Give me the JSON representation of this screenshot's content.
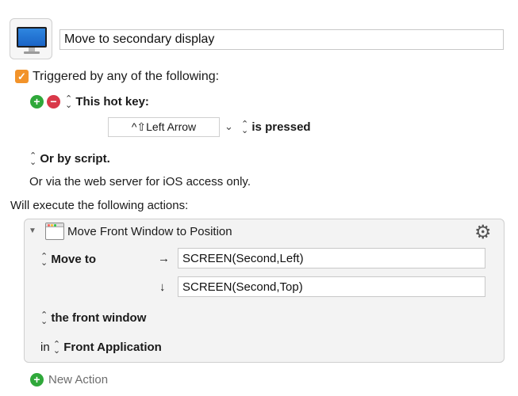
{
  "macro": {
    "icon": "monitor-icon",
    "name": "Move to secondary display"
  },
  "trigger": {
    "enabled": true,
    "label": "Triggered by any of the following:",
    "hotkey_label": "This hot key:",
    "hotkey_value": "^⇧Left Arrow",
    "hotkey_state": "is pressed",
    "script_label": "Or by script.",
    "web_label": "Or via the web server for iOS access only."
  },
  "actions": {
    "header": "Will execute the following actions:",
    "items": [
      {
        "title": "Move Front Window to Position",
        "move_label": "Move to",
        "x_arrow": "→",
        "y_arrow": "↓",
        "x_value": "SCREEN(Second,Left)",
        "y_value": "SCREEN(Second,Top)",
        "window_label": "the front window",
        "in_label": "in",
        "app_label": "Front Application"
      }
    ],
    "new_action_label": "New Action"
  },
  "colors": {
    "accent_orange": "#f2932a",
    "add_green": "#2fa83a",
    "remove_red": "#d93849",
    "screen_blue": "#1a64c6"
  }
}
